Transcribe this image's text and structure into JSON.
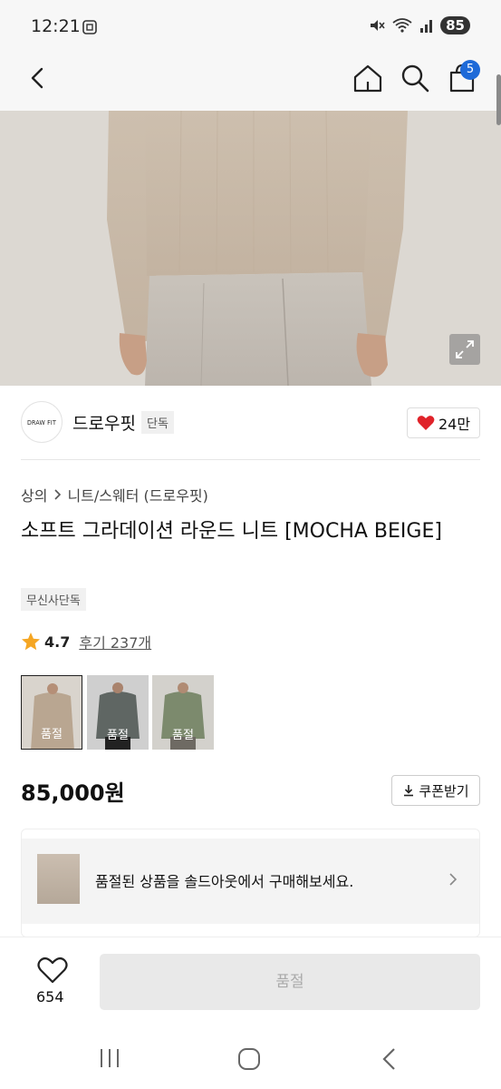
{
  "status_bar": {
    "time": "12:21",
    "battery": "85"
  },
  "cart": {
    "count": "5"
  },
  "brand": {
    "logo_text": "DRAW FIT",
    "name": "드로우핏",
    "badge": "단독",
    "likes": "24만"
  },
  "breadcrumb": {
    "level1": "상의",
    "level2": "니트/스웨터 (드로우핏)"
  },
  "product": {
    "title": "소프트 그라데이션 라운드 니트 [MOCHA BEIGE]",
    "exclusive_tag": "무신사단독",
    "rating": "4.7",
    "reviews": "후기 237개",
    "price": "85,000원",
    "coupon_label": "쿠폰받기"
  },
  "color_options": [
    {
      "label": "품절",
      "tone": "mocha"
    },
    {
      "label": "품절",
      "tone": "charcoal"
    },
    {
      "label": "품절",
      "tone": "khaki"
    }
  ],
  "soldout_banner": {
    "text": "품절된 상품을 솔드아웃에서 구매해보세요."
  },
  "bottom_bar": {
    "heart_count": "654",
    "buy_label": "품절"
  },
  "colors": {
    "accent_blue": "#1e6ad8",
    "heart_red": "#e0232a",
    "star_gold": "#f5a623"
  }
}
